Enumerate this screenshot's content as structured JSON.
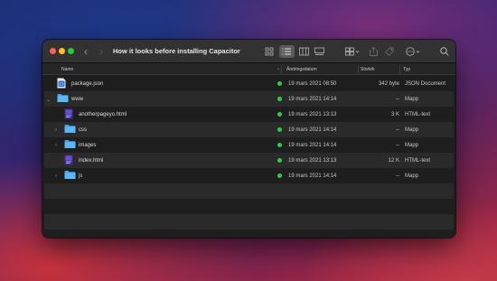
{
  "window": {
    "title": "How it looks before installing Capacitor"
  },
  "toolbar": {
    "back": "‹",
    "forward": "›",
    "icons": [
      "icon-view-icon",
      "list-view-icon",
      "column-view-icon",
      "gallery-view-icon",
      "group-icon",
      "share-icon",
      "tag-icon",
      "action-icon",
      "search-icon"
    ]
  },
  "columns": {
    "name": "Namn",
    "date": "Ändringsdatum",
    "size": "Storlek",
    "kind": "Typ",
    "sort_indicator": "⌄"
  },
  "colors": {
    "folder": "#3aa6ef",
    "status_dot": "#36c84a",
    "window_bg": "#1e1e1e"
  },
  "files": [
    {
      "name": "package.json",
      "date": "19 mars 2021 08:50",
      "size": "342 byte",
      "kind": "JSON Document",
      "icon": "json-file-icon",
      "indent": 0,
      "disclosure": ""
    },
    {
      "name": "www",
      "date": "19 mars 2021 14:14",
      "size": "--",
      "kind": "Mapp",
      "icon": "folder-icon",
      "indent": 0,
      "disclosure": "⌄"
    },
    {
      "name": "anotherpageyo.html",
      "date": "19 mars 2021 13:13",
      "size": "3 K",
      "kind": "HTML-text",
      "icon": "html-file-icon",
      "indent": 1,
      "disclosure": ""
    },
    {
      "name": "css",
      "date": "19 mars 2021 14:14",
      "size": "--",
      "kind": "Mapp",
      "icon": "folder-icon",
      "indent": 1,
      "disclosure": "›"
    },
    {
      "name": "images",
      "date": "19 mars 2021 14:14",
      "size": "--",
      "kind": "Mapp",
      "icon": "folder-icon",
      "indent": 1,
      "disclosure": "›"
    },
    {
      "name": "index.html",
      "date": "19 mars 2021 13:13",
      "size": "12 K",
      "kind": "HTML-text",
      "icon": "html-file-icon",
      "indent": 1,
      "disclosure": ""
    },
    {
      "name": "js",
      "date": "19 mars 2021 14:14",
      "size": "--",
      "kind": "Mapp",
      "icon": "folder-icon",
      "indent": 1,
      "disclosure": "›"
    }
  ]
}
